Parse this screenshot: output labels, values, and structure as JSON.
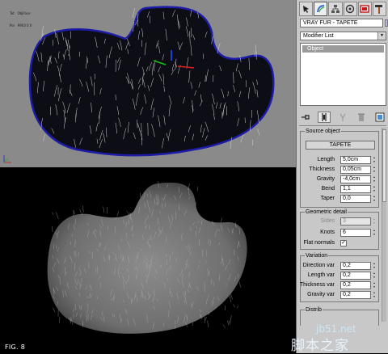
{
  "viewport_top": {
    "stats_lines": [
      "Tot   ObjFace",
      "Pol   9903 0 0",
      "Pol:  1",
      "Ve:   0"
    ],
    "axis_labels": [
      "x",
      "y",
      "z"
    ]
  },
  "figure_label": "FIG. 8",
  "watermark": {
    "line1": "jb51.net",
    "line2": "脚本之家"
  },
  "command_panel": {
    "tabs": [
      {
        "name": "create-tab",
        "icon": "cursor-star-icon"
      },
      {
        "name": "modify-tab",
        "icon": "rainbow-bend-icon"
      },
      {
        "name": "hierarchy-tab",
        "icon": "hierarchy-icon"
      },
      {
        "name": "motion-tab",
        "icon": "motion-icon"
      },
      {
        "name": "display-tab",
        "icon": "display-icon"
      },
      {
        "name": "utilities-tab",
        "icon": "hammer-icon"
      }
    ],
    "object_name": "VRAY FUR - TAPETE",
    "object_color": "#c0b4d8",
    "modifier_list": "Modifier List",
    "stack_item": "Object",
    "source_object": {
      "title": "Source object",
      "button": "TAPETE",
      "rows": [
        {
          "label": "Length",
          "value": "5,0cm"
        },
        {
          "label": "Thickness",
          "value": "0,05cm"
        },
        {
          "label": "Gravity",
          "value": "-4,0cm"
        },
        {
          "label": "Bend",
          "value": "1,1"
        },
        {
          "label": "Taper",
          "value": "0,0"
        }
      ]
    },
    "geometric_detail": {
      "title": "Geometric detail",
      "sides_label": "Sides",
      "sides_value": "3",
      "knots_label": "Knots",
      "knots_value": "6",
      "flat_normals_label": "Flat normals",
      "flat_normals_checked": "✓"
    },
    "variation": {
      "title": "Variation",
      "rows": [
        {
          "label": "Direction var",
          "value": "0,2"
        },
        {
          "label": "Length var",
          "value": "0,2"
        },
        {
          "label": "Thickness var",
          "value": "0,2"
        },
        {
          "label": "Gravity var",
          "value": "0,2"
        }
      ]
    },
    "distribution_title": "Distrib"
  }
}
